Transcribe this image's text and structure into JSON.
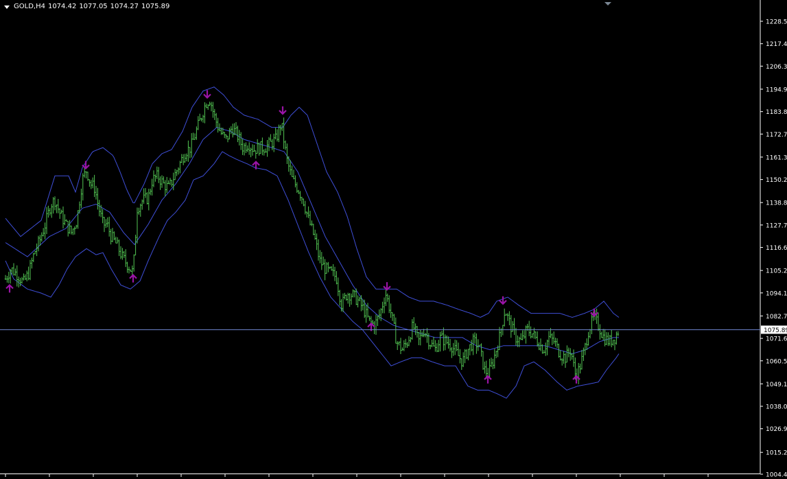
{
  "header": {
    "symbol": "GOLD,H4",
    "open": "1074.42",
    "high": "1077.05",
    "low": "1074.27",
    "close": "1075.89"
  },
  "colors": {
    "background": "#000000",
    "candle": "#53c653",
    "band": "#3f4fd8",
    "arrow": "#9a14a6",
    "price_line": "#6b82c9",
    "axis": "#ffffff",
    "price_tag_bg": "#ffffff",
    "price_tag_text": "#000000"
  },
  "icons": {
    "menu": "dropdown-triangle-icon",
    "scroll_marker": "chart-shift-triangle-icon",
    "signal_down": "arrow-down-icon",
    "signal_up": "arrow-up-icon"
  },
  "chart_data": {
    "type": "bar",
    "symbol": "GOLD",
    "timeframe": "H4",
    "current_price": 1075.89,
    "ylim": [
      1004.4,
      1228.5
    ],
    "price_ticks": [
      "1228.50",
      "1217.40",
      "1206.30",
      "1194.90",
      "1183.80",
      "1172.70",
      "1161.30",
      "1150.20",
      "1138.80",
      "1127.70",
      "1116.60",
      "1105.20",
      "1094.10",
      "1082.70",
      "1071.60",
      "1060.50",
      "1049.10",
      "1038.00",
      "1026.90",
      "1015.20",
      "1004.40"
    ],
    "x_grid_count": 17,
    "close_path": [
      [
        0,
        1110
      ],
      [
        8,
        1101
      ],
      [
        16,
        1106
      ],
      [
        26,
        1103
      ],
      [
        34,
        1099
      ],
      [
        42,
        1104
      ],
      [
        50,
        1114
      ],
      [
        58,
        1120
      ],
      [
        66,
        1128
      ],
      [
        74,
        1138
      ],
      [
        80,
        1140
      ],
      [
        88,
        1133
      ],
      [
        96,
        1128
      ],
      [
        104,
        1124
      ],
      [
        112,
        1130
      ],
      [
        120,
        1150
      ],
      [
        126,
        1155
      ],
      [
        132,
        1148
      ],
      [
        138,
        1146
      ],
      [
        144,
        1136
      ],
      [
        150,
        1128
      ],
      [
        156,
        1128
      ],
      [
        162,
        1122
      ],
      [
        170,
        1118
      ],
      [
        178,
        1112
      ],
      [
        186,
        1108
      ],
      [
        194,
        1104
      ],
      [
        200,
        1136
      ],
      [
        208,
        1140
      ],
      [
        216,
        1141
      ],
      [
        222,
        1150
      ],
      [
        230,
        1152
      ],
      [
        238,
        1148
      ],
      [
        246,
        1146
      ],
      [
        254,
        1152
      ],
      [
        262,
        1158
      ],
      [
        270,
        1164
      ],
      [
        278,
        1166
      ],
      [
        286,
        1174
      ],
      [
        294,
        1182
      ],
      [
        300,
        1188
      ],
      [
        306,
        1190
      ],
      [
        312,
        1182
      ],
      [
        318,
        1176
      ],
      [
        324,
        1172
      ],
      [
        330,
        1170
      ],
      [
        338,
        1176
      ],
      [
        346,
        1172
      ],
      [
        354,
        1166
      ],
      [
        362,
        1168
      ],
      [
        370,
        1165
      ],
      [
        378,
        1166
      ],
      [
        386,
        1166
      ],
      [
        394,
        1168
      ],
      [
        402,
        1170
      ],
      [
        410,
        1178
      ],
      [
        418,
        1160
      ],
      [
        426,
        1150
      ],
      [
        434,
        1146
      ],
      [
        442,
        1140
      ],
      [
        450,
        1130
      ],
      [
        458,
        1122
      ],
      [
        466,
        1110
      ],
      [
        474,
        1106
      ],
      [
        482,
        1104
      ],
      [
        490,
        1102
      ],
      [
        498,
        1088
      ],
      [
        506,
        1094
      ],
      [
        514,
        1093
      ],
      [
        522,
        1090
      ],
      [
        530,
        1086
      ],
      [
        538,
        1080
      ],
      [
        546,
        1078
      ],
      [
        554,
        1084
      ],
      [
        562,
        1094
      ],
      [
        570,
        1084
      ],
      [
        578,
        1070
      ],
      [
        586,
        1066
      ],
      [
        594,
        1070
      ],
      [
        602,
        1078
      ],
      [
        610,
        1070
      ],
      [
        618,
        1076
      ],
      [
        626,
        1070
      ],
      [
        634,
        1066
      ],
      [
        642,
        1072
      ],
      [
        650,
        1070
      ],
      [
        658,
        1068
      ],
      [
        666,
        1064
      ],
      [
        674,
        1060
      ],
      [
        682,
        1066
      ],
      [
        690,
        1070
      ],
      [
        698,
        1068
      ],
      [
        706,
        1056
      ],
      [
        712,
        1054
      ],
      [
        720,
        1062
      ],
      [
        728,
        1072
      ],
      [
        736,
        1086
      ],
      [
        744,
        1078
      ],
      [
        752,
        1072
      ],
      [
        760,
        1070
      ],
      [
        768,
        1076
      ],
      [
        776,
        1074
      ],
      [
        784,
        1070
      ],
      [
        792,
        1066
      ],
      [
        800,
        1072
      ],
      [
        808,
        1070
      ],
      [
        816,
        1064
      ],
      [
        824,
        1062
      ],
      [
        832,
        1066
      ],
      [
        838,
        1054
      ],
      [
        844,
        1056
      ],
      [
        852,
        1066
      ],
      [
        858,
        1076
      ],
      [
        866,
        1082
      ],
      [
        872,
        1078
      ],
      [
        880,
        1072
      ],
      [
        888,
        1070
      ],
      [
        896,
        1072
      ],
      [
        902,
        1076
      ]
    ],
    "upper_band_path": [
      [
        8,
        1131
      ],
      [
        30,
        1122
      ],
      [
        60,
        1130
      ],
      [
        80,
        1152
      ],
      [
        100,
        1152
      ],
      [
        110,
        1144
      ],
      [
        120,
        1156
      ],
      [
        135,
        1164
      ],
      [
        150,
        1166
      ],
      [
        165,
        1162
      ],
      [
        175,
        1154
      ],
      [
        185,
        1145
      ],
      [
        195,
        1138
      ],
      [
        210,
        1148
      ],
      [
        222,
        1158
      ],
      [
        236,
        1163
      ],
      [
        250,
        1165
      ],
      [
        266,
        1174
      ],
      [
        280,
        1186
      ],
      [
        296,
        1194
      ],
      [
        312,
        1196
      ],
      [
        326,
        1192
      ],
      [
        340,
        1186
      ],
      [
        356,
        1182
      ],
      [
        376,
        1180
      ],
      [
        396,
        1176
      ],
      [
        412,
        1176
      ],
      [
        424,
        1182
      ],
      [
        436,
        1186
      ],
      [
        448,
        1182
      ],
      [
        462,
        1168
      ],
      [
        476,
        1154
      ],
      [
        492,
        1144
      ],
      [
        506,
        1132
      ],
      [
        520,
        1116
      ],
      [
        534,
        1102
      ],
      [
        548,
        1096
      ],
      [
        562,
        1096
      ],
      [
        578,
        1096
      ],
      [
        596,
        1092
      ],
      [
        612,
        1090
      ],
      [
        632,
        1090
      ],
      [
        652,
        1088
      ],
      [
        668,
        1086
      ],
      [
        686,
        1084
      ],
      [
        700,
        1082
      ],
      [
        712,
        1084
      ],
      [
        724,
        1090
      ],
      [
        740,
        1092
      ],
      [
        756,
        1088
      ],
      [
        774,
        1084
      ],
      [
        796,
        1084
      ],
      [
        816,
        1084
      ],
      [
        834,
        1082
      ],
      [
        852,
        1084
      ],
      [
        866,
        1086
      ],
      [
        880,
        1090
      ],
      [
        894,
        1084
      ],
      [
        902,
        1082
      ]
    ],
    "lower_band_path": [
      [
        8,
        1110
      ],
      [
        20,
        1101
      ],
      [
        40,
        1096
      ],
      [
        60,
        1094
      ],
      [
        74,
        1092
      ],
      [
        86,
        1098
      ],
      [
        98,
        1106
      ],
      [
        110,
        1112
      ],
      [
        126,
        1116
      ],
      [
        140,
        1113
      ],
      [
        150,
        1114
      ],
      [
        162,
        1106
      ],
      [
        176,
        1098
      ],
      [
        190,
        1096
      ],
      [
        204,
        1100
      ],
      [
        216,
        1110
      ],
      [
        232,
        1122
      ],
      [
        244,
        1130
      ],
      [
        256,
        1134
      ],
      [
        270,
        1140
      ],
      [
        282,
        1150
      ],
      [
        296,
        1152
      ],
      [
        312,
        1158
      ],
      [
        324,
        1164
      ],
      [
        334,
        1162
      ],
      [
        346,
        1160
      ],
      [
        360,
        1158
      ],
      [
        372,
        1156
      ],
      [
        388,
        1155
      ],
      [
        404,
        1152
      ],
      [
        420,
        1140
      ],
      [
        436,
        1126
      ],
      [
        450,
        1114
      ],
      [
        466,
        1102
      ],
      [
        482,
        1092
      ],
      [
        498,
        1086
      ],
      [
        514,
        1080
      ],
      [
        528,
        1076
      ],
      [
        542,
        1070
      ],
      [
        556,
        1064
      ],
      [
        570,
        1058
      ],
      [
        584,
        1060
      ],
      [
        600,
        1062
      ],
      [
        614,
        1062
      ],
      [
        630,
        1060
      ],
      [
        648,
        1058
      ],
      [
        664,
        1058
      ],
      [
        682,
        1048
      ],
      [
        696,
        1046
      ],
      [
        712,
        1046
      ],
      [
        726,
        1044
      ],
      [
        738,
        1042
      ],
      [
        752,
        1048
      ],
      [
        764,
        1058
      ],
      [
        778,
        1060
      ],
      [
        794,
        1056
      ],
      [
        812,
        1050
      ],
      [
        826,
        1046
      ],
      [
        842,
        1048
      ],
      [
        858,
        1049
      ],
      [
        872,
        1050
      ],
      [
        884,
        1056
      ],
      [
        898,
        1062
      ],
      [
        902,
        1064
      ]
    ],
    "middle_band_path": [
      [
        8,
        1119
      ],
      [
        40,
        1112
      ],
      [
        72,
        1122
      ],
      [
        96,
        1126
      ],
      [
        120,
        1136
      ],
      [
        140,
        1138
      ],
      [
        160,
        1134
      ],
      [
        180,
        1124
      ],
      [
        196,
        1118
      ],
      [
        216,
        1128
      ],
      [
        236,
        1140
      ],
      [
        256,
        1148
      ],
      [
        276,
        1158
      ],
      [
        296,
        1170
      ],
      [
        316,
        1176
      ],
      [
        336,
        1174
      ],
      [
        356,
        1170
      ],
      [
        376,
        1168
      ],
      [
        396,
        1166
      ],
      [
        414,
        1164
      ],
      [
        434,
        1154
      ],
      [
        454,
        1138
      ],
      [
        474,
        1122
      ],
      [
        494,
        1110
      ],
      [
        514,
        1098
      ],
      [
        534,
        1088
      ],
      [
        554,
        1082
      ],
      [
        574,
        1078
      ],
      [
        594,
        1076
      ],
      [
        614,
        1074
      ],
      [
        634,
        1072
      ],
      [
        654,
        1072
      ],
      [
        674,
        1072
      ],
      [
        694,
        1068
      ],
      [
        714,
        1066
      ],
      [
        734,
        1068
      ],
      [
        754,
        1068
      ],
      [
        774,
        1068
      ],
      [
        794,
        1068
      ],
      [
        814,
        1066
      ],
      [
        834,
        1064
      ],
      [
        854,
        1066
      ],
      [
        874,
        1070
      ],
      [
        894,
        1072
      ],
      [
        902,
        1072
      ]
    ],
    "down_arrows": [
      [
        14,
        1099
      ],
      [
        125,
        1155
      ],
      [
        194,
        1104
      ],
      [
        302,
        1190
      ],
      [
        373,
        1160
      ],
      [
        412,
        1182
      ],
      [
        541,
        1080
      ],
      [
        564,
        1095
      ],
      [
        711,
        1054
      ],
      [
        733,
        1088
      ],
      [
        840,
        1054
      ],
      [
        866,
        1082
      ]
    ],
    "down_arrow_x": [
      125,
      302,
      412,
      564,
      733,
      866
    ],
    "up_arrow_x": [
      14,
      194,
      373,
      541,
      711,
      840
    ]
  }
}
